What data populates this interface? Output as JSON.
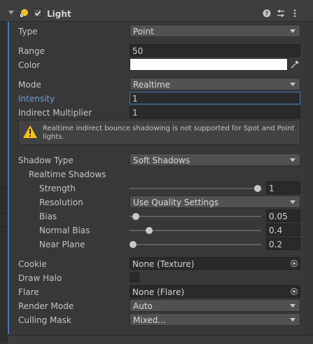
{
  "header": {
    "title": "Light",
    "enabled": true
  },
  "fields": {
    "type": {
      "label": "Type",
      "value": "Point"
    },
    "range": {
      "label": "Range",
      "value": "50"
    },
    "color": {
      "label": "Color",
      "value": "#ffffff"
    },
    "mode": {
      "label": "Mode",
      "value": "Realtime"
    },
    "intensity": {
      "label": "Intensity",
      "value": "1"
    },
    "indirect_multiplier": {
      "label": "Indirect Multiplier",
      "value": "1"
    },
    "warning": "Realtime indirect bounce shadowing is not supported for Spot and Point lights.",
    "shadow_type": {
      "label": "Shadow Type",
      "value": "Soft Shadows"
    },
    "realtime_shadows": "Realtime Shadows",
    "strength": {
      "label": "Strength",
      "value": "1",
      "slider_fraction": 1.0
    },
    "resolution": {
      "label": "Resolution",
      "value": "Use Quality Settings"
    },
    "bias": {
      "label": "Bias",
      "value": "0.05",
      "slider_fraction": 0.025
    },
    "normal_bias": {
      "label": "Normal Bias",
      "value": "0.4",
      "slider_fraction": 0.13
    },
    "near_plane": {
      "label": "Near Plane",
      "value": "0.2",
      "slider_fraction": 0.0
    },
    "cookie": {
      "label": "Cookie",
      "value": "None (Texture)"
    },
    "draw_halo": {
      "label": "Draw Halo",
      "checked": false
    },
    "flare": {
      "label": "Flare",
      "value": "None (Flare)"
    },
    "render_mode": {
      "label": "Render Mode",
      "value": "Auto"
    },
    "culling_mask": {
      "label": "Culling Mask",
      "value": "Mixed..."
    }
  },
  "colors": {
    "accent": "#3a79bb",
    "intensity_label": "#6a9fd8",
    "warning": "#f6c21a"
  },
  "icons": [
    "foldout-arrow",
    "light-bulb-icon",
    "help-icon",
    "preset-icon",
    "more-icon",
    "eyedropper-icon",
    "warning-icon",
    "object-picker-icon"
  ]
}
